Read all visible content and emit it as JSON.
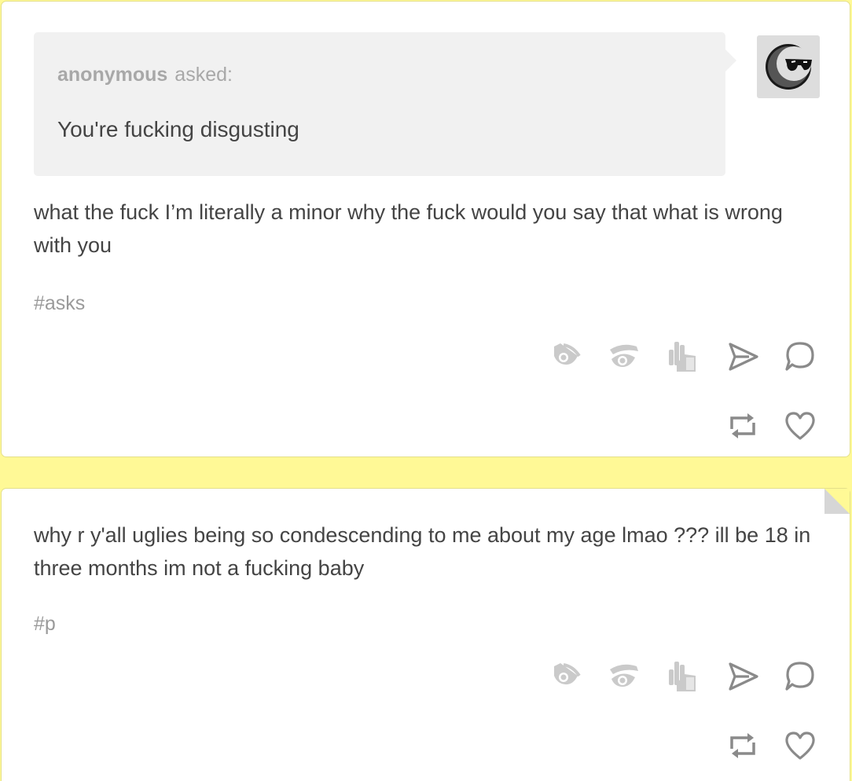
{
  "posts": [
    {
      "ask": {
        "asker_name": "anonymous",
        "asker_verb": "asked:",
        "question": "You're fucking disgusting"
      },
      "avatar": "sunglasses-moon-avatar",
      "body": "what the fuck I’m literally a minor why the fuck would you say that what is wrong with you",
      "tags": [
        "#asks"
      ],
      "actions": [
        "eye-dash-icon",
        "eye-brow-icon",
        "hand-icon",
        "send-icon",
        "comment-icon",
        "reblog-icon",
        "heart-icon"
      ]
    },
    {
      "body": "why r y'all uglies being so condescending to me about my age lmao ??? ill be 18 in three months im not a fucking baby",
      "tags": [
        "#p"
      ],
      "actions": [
        "eye-dash-icon",
        "eye-brow-icon",
        "hand-icon",
        "send-icon",
        "comment-icon",
        "reblog-icon",
        "heart-icon"
      ]
    }
  ],
  "colors": {
    "background": "#fff996",
    "card": "#ffffff",
    "ask_box": "#f1f1f1",
    "text": "#444444",
    "muted": "#a8a8a8",
    "icon_light": "#c9c9c9",
    "icon_dark": "#8a8a8a"
  }
}
